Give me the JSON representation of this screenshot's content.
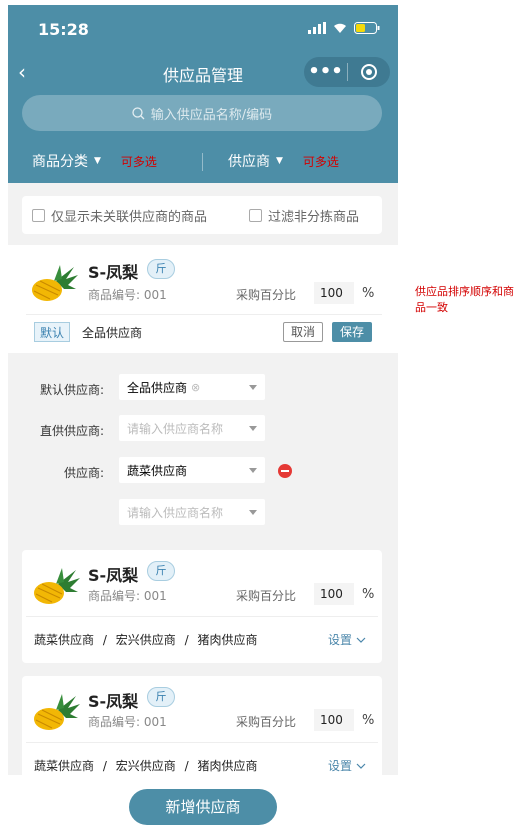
{
  "status": {
    "time": "15:28"
  },
  "nav": {
    "title": "供应品管理",
    "more": "•••"
  },
  "search": {
    "placeholder": "输入供应品名称/编码"
  },
  "filters": {
    "category": "商品分类",
    "category_note": "可多选",
    "supplier": "供应商",
    "supplier_note": "可多选"
  },
  "checks": {
    "only_unlinked": "仅显示未关联供应商的商品",
    "filter_unsorted": "过滤非分拣商品"
  },
  "products": [
    {
      "name": "S-凤梨",
      "unit": "斤",
      "code": "商品编号: 001",
      "pct_label": "采购百分比",
      "pct_value": "100",
      "pct_sign": "%"
    },
    {
      "name": "S-凤梨",
      "unit": "斤",
      "code": "商品编号: 001",
      "pct_label": "采购百分比",
      "pct_value": "100",
      "pct_sign": "%",
      "suppliers": [
        "蔬菜供应商",
        "宏兴供应商",
        "猪肉供应商"
      ],
      "setting": "设置"
    },
    {
      "name": "S-凤梨",
      "unit": "斤",
      "code": "商品编号: 001",
      "pct_label": "采购百分比",
      "pct_value": "100",
      "pct_sign": "%",
      "suppliers": [
        "蔬菜供应商",
        "宏兴供应商",
        "猪肉供应商"
      ],
      "setting": "设置"
    }
  ],
  "edit": {
    "default_tag": "默认",
    "default_supplier": "全品供应商",
    "cancel": "取消",
    "save": "保存"
  },
  "form": {
    "default_label": "默认供应商:",
    "default_value": "全品供应商",
    "direct_label": "直供供应商:",
    "direct_placeholder": "请输入供应商名称",
    "supplier_label": "供应商:",
    "supplier_value": "蔬菜供应商",
    "extra_placeholder": "请输入供应商名称"
  },
  "separator": "/",
  "bottom": {
    "add_button": "新增供应商"
  },
  "annotation": "供应品排序顺序和商品一致",
  "colors": {
    "brand": "#4d8ea7",
    "accent_red": "#d30000",
    "link": "#4a86aa"
  }
}
